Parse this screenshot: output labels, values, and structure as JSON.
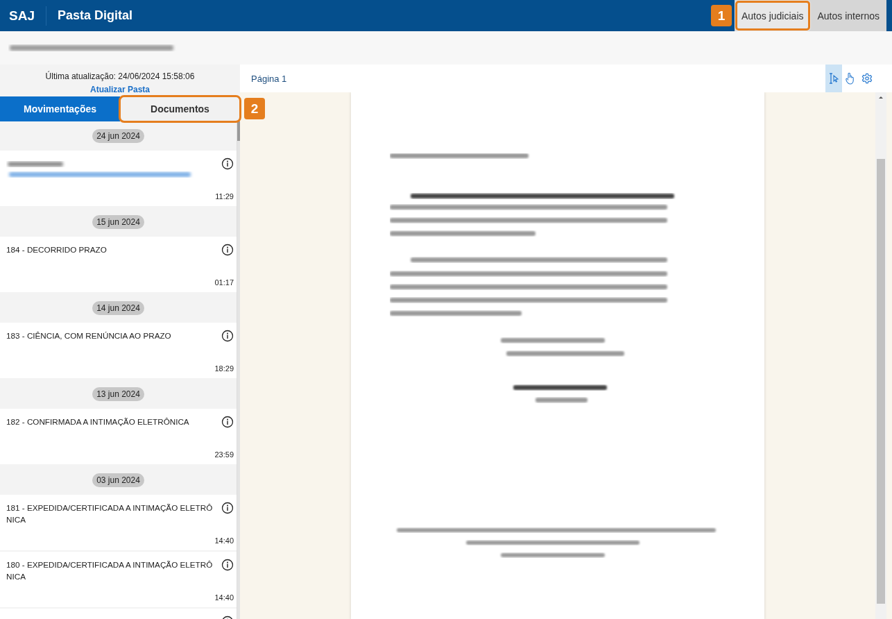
{
  "header": {
    "logo": "SAJ",
    "title": "Pasta Digital",
    "tabs": [
      {
        "label": "Autos judiciais",
        "selected": true,
        "callout": "1"
      },
      {
        "label": "Autos internos",
        "selected": false
      }
    ]
  },
  "sidebar": {
    "last_update": "Última atualização: 24/06/2024 15:58:06",
    "refresh_link": "Atualizar Pasta",
    "tabs": [
      {
        "label": "Movimentações",
        "selected": true
      },
      {
        "label": "Documentos",
        "selected": false,
        "callout": "2"
      }
    ],
    "groups": [
      {
        "date": "24 jun 2024",
        "items": [
          {
            "kind": "blurred",
            "time": "11:29"
          }
        ]
      },
      {
        "date": "15 jun 2024",
        "items": [
          {
            "kind": "text",
            "title": "184 - DECORRIDO PRAZO",
            "time": "01:17"
          }
        ]
      },
      {
        "date": "14 jun 2024",
        "items": [
          {
            "kind": "text",
            "title": "183 - CIÊNCIA, COM RENÚNCIA AO PRAZO",
            "time": "18:29"
          }
        ]
      },
      {
        "date": "13 jun 2024",
        "items": [
          {
            "kind": "text",
            "title": "182 - CONFIRMADA A INTIMAÇÃO ELETRÔNICA",
            "time": "23:59"
          }
        ]
      },
      {
        "date": "03 jun 2024",
        "items": [
          {
            "kind": "text",
            "title": "181 - EXPEDIDA/CERTIFICADA A INTIMAÇÃO ELETRÔNICA",
            "time": "14:40"
          },
          {
            "kind": "text",
            "title": "180 - EXPEDIDA/CERTIFICADA A INTIMAÇÃO ELETRÔNICA",
            "time": "14:40"
          },
          {
            "kind": "cut"
          }
        ]
      }
    ]
  },
  "viewer": {
    "page_label": "Página 1",
    "tools": [
      {
        "kind": "text-select",
        "selected": true
      },
      {
        "kind": "hand",
        "selected": false
      },
      {
        "kind": "settings",
        "selected": false
      }
    ]
  }
}
